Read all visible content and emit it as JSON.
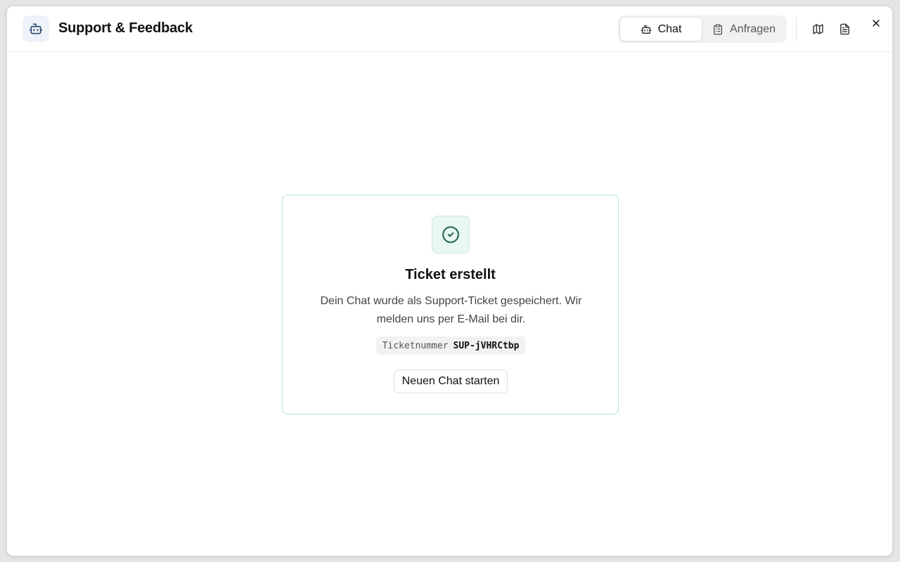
{
  "app": {
    "title": "Support & Feedback",
    "logo_icon": "robot-icon",
    "accent": "#b3e6d0"
  },
  "tabs": [
    {
      "label": "Chat",
      "icon": "robot-icon",
      "active": true
    },
    {
      "label": "Anfragen",
      "icon": "clipboard-icon",
      "active": false
    }
  ],
  "toolbar": {
    "icons": [
      "map-icon",
      "document-icon",
      "close-icon"
    ]
  },
  "confirmation": {
    "icon": "check-circle-icon",
    "title": "Ticket erstellt",
    "description": "Dein Chat wurde als Support-Ticket gespeichert. Wir melden uns per E-Mail bei dir.",
    "ticket_label": "Ticketnummer",
    "ticket_id": "SUP-jVHRCtbp",
    "new_chat_button": "Neuen Chat starten",
    "success_color": "#2d6a52"
  }
}
